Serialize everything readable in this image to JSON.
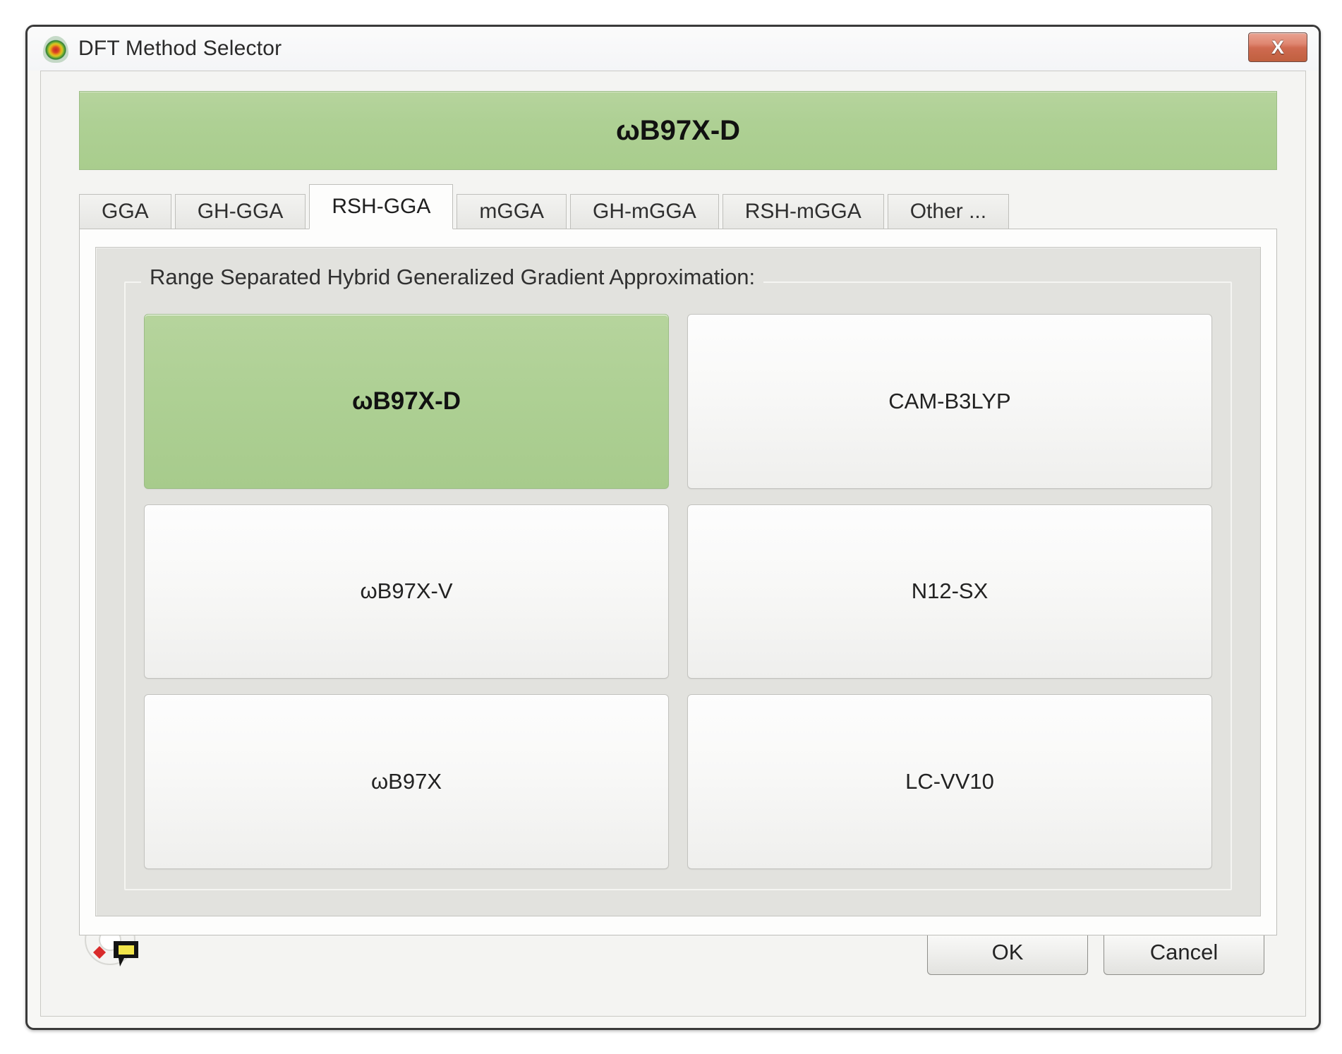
{
  "window": {
    "title": "DFT Method Selector",
    "app_icon": "density-blob-icon",
    "close_label": "X"
  },
  "selected": {
    "method": "ωB97X-D"
  },
  "tabs": [
    {
      "label": "GGA",
      "active": false
    },
    {
      "label": "GH-GGA",
      "active": false
    },
    {
      "label": "RSH-GGA",
      "active": true
    },
    {
      "label": "mGGA",
      "active": false
    },
    {
      "label": "GH-mGGA",
      "active": false
    },
    {
      "label": "RSH-mGGA",
      "active": false
    },
    {
      "label": "Other ...",
      "active": false
    }
  ],
  "groupbox": {
    "legend": "Range Separated Hybrid Generalized Gradient Approximation:"
  },
  "methods": [
    {
      "label": "ωB97X-D",
      "selected": true
    },
    {
      "label": "CAM-B3LYP",
      "selected": false
    },
    {
      "label": "ωB97X-V",
      "selected": false
    },
    {
      "label": "N12-SX",
      "selected": false
    },
    {
      "label": "ωB97X",
      "selected": false
    },
    {
      "label": "LC-VV10",
      "selected": false
    }
  ],
  "footer": {
    "help_icon": "lifesaver-help-icon",
    "ok_label": "OK",
    "cancel_label": "Cancel"
  },
  "colors": {
    "selection_green": "#aed094",
    "selection_green_border": "#9cbd86",
    "close_red": "#cf6a50",
    "window_border": "#3a3a3a",
    "panel_grey": "#e2e2de"
  }
}
